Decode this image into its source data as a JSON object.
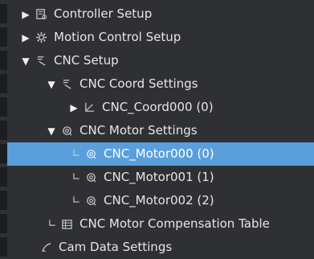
{
  "tree": {
    "items": [
      {
        "label": "Controller Setup",
        "icon": "controller-setup-icon",
        "expander": "collapsed"
      },
      {
        "label": "Motion Control Setup",
        "icon": "gear-icon",
        "expander": "collapsed"
      },
      {
        "label": "CNC Setup",
        "icon": "cnc-icon",
        "expander": "expanded"
      },
      {
        "label": "CNC Coord Settings",
        "icon": "cnc-coord-icon",
        "expander": "expanded"
      },
      {
        "label": "CNC_Coord000 (0)",
        "icon": "coord-axes-icon",
        "expander": "collapsed"
      },
      {
        "label": "CNC Motor Settings",
        "icon": "motor-settings-icon",
        "expander": "expanded"
      },
      {
        "label": "CNC_Motor000 (0)",
        "icon": "motor-icon",
        "selected": true
      },
      {
        "label": "CNC_Motor001 (1)",
        "icon": "motor-icon"
      },
      {
        "label": "CNC_Motor002 (2)",
        "icon": "motor-icon"
      },
      {
        "label": "CNC Motor Compensation Table",
        "icon": "table-icon"
      },
      {
        "label": "Cam Data Settings",
        "icon": "cam-icon"
      }
    ]
  },
  "colors": {
    "background": "#2f3033",
    "selected_row": "#5a9fdc",
    "text": "#e6e6e6"
  }
}
